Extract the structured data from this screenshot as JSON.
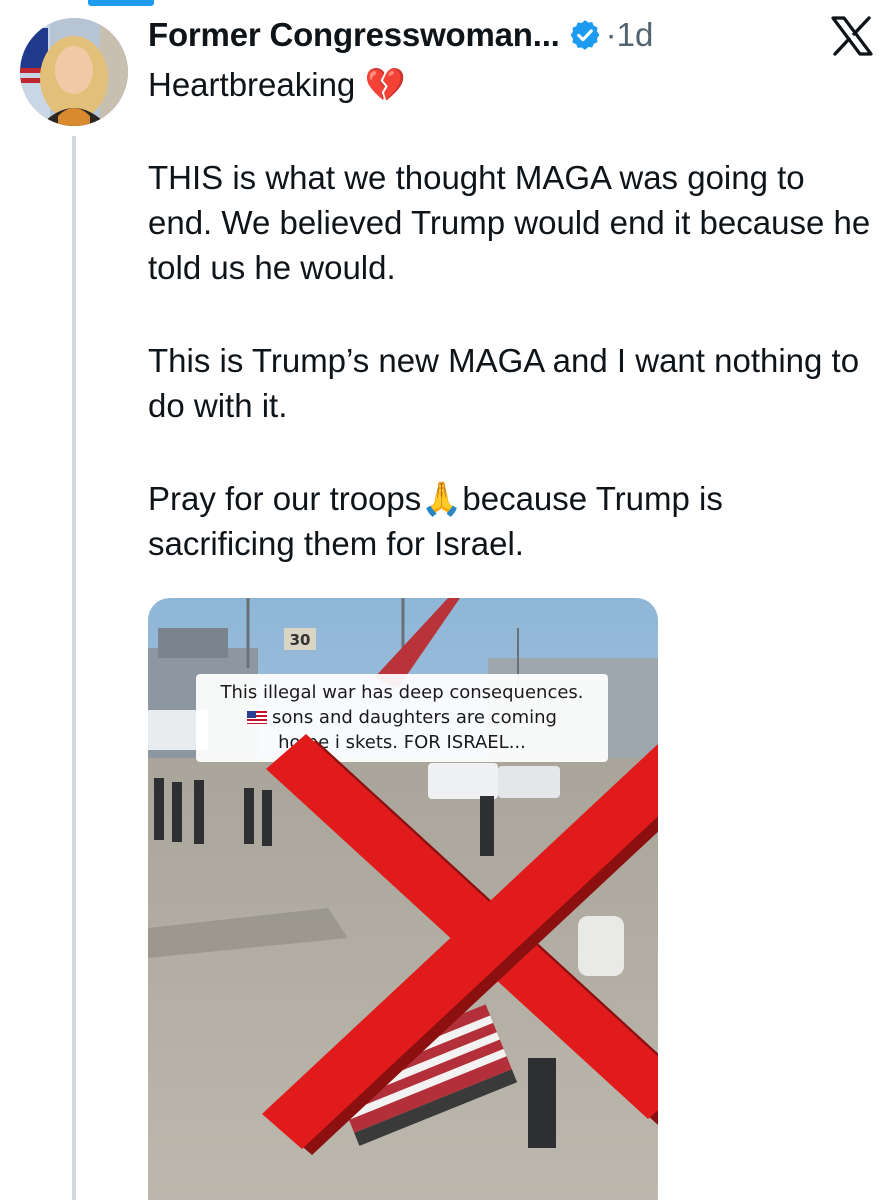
{
  "author": {
    "display_name": "Former Congresswoman...",
    "separator": "·",
    "time": "1d",
    "verified": true,
    "verified_color": "#1d9bf0"
  },
  "header": {
    "platform_icon": "x-logo-icon"
  },
  "tweet": {
    "line1": "Heartbreaking",
    "line1_emoji": "💔",
    "para1": "THIS is what we thought MAGA was going to end. We believed Trump would end it because he told us he would.",
    "para2": "This is Trump’s new MAGA and I want nothing to do with it.",
    "para3_before": "Pray for our troops",
    "para3_emoji": "🙏",
    "para3_after": "because Trump is sacrificing them for Israel."
  },
  "media": {
    "caption_line1": "This illegal war has deep consequences.",
    "caption_line2": "sons and daughters are coming",
    "caption_line3": "home i    skets. FOR ISRAEL...",
    "gate_number": "30",
    "overlay_icon": "red-x-icon",
    "overlay_color": "#e11b1b"
  },
  "colors": {
    "accent": "#1d9bf0",
    "secondary_text": "#536471",
    "thread_line": "#d4d9de"
  }
}
